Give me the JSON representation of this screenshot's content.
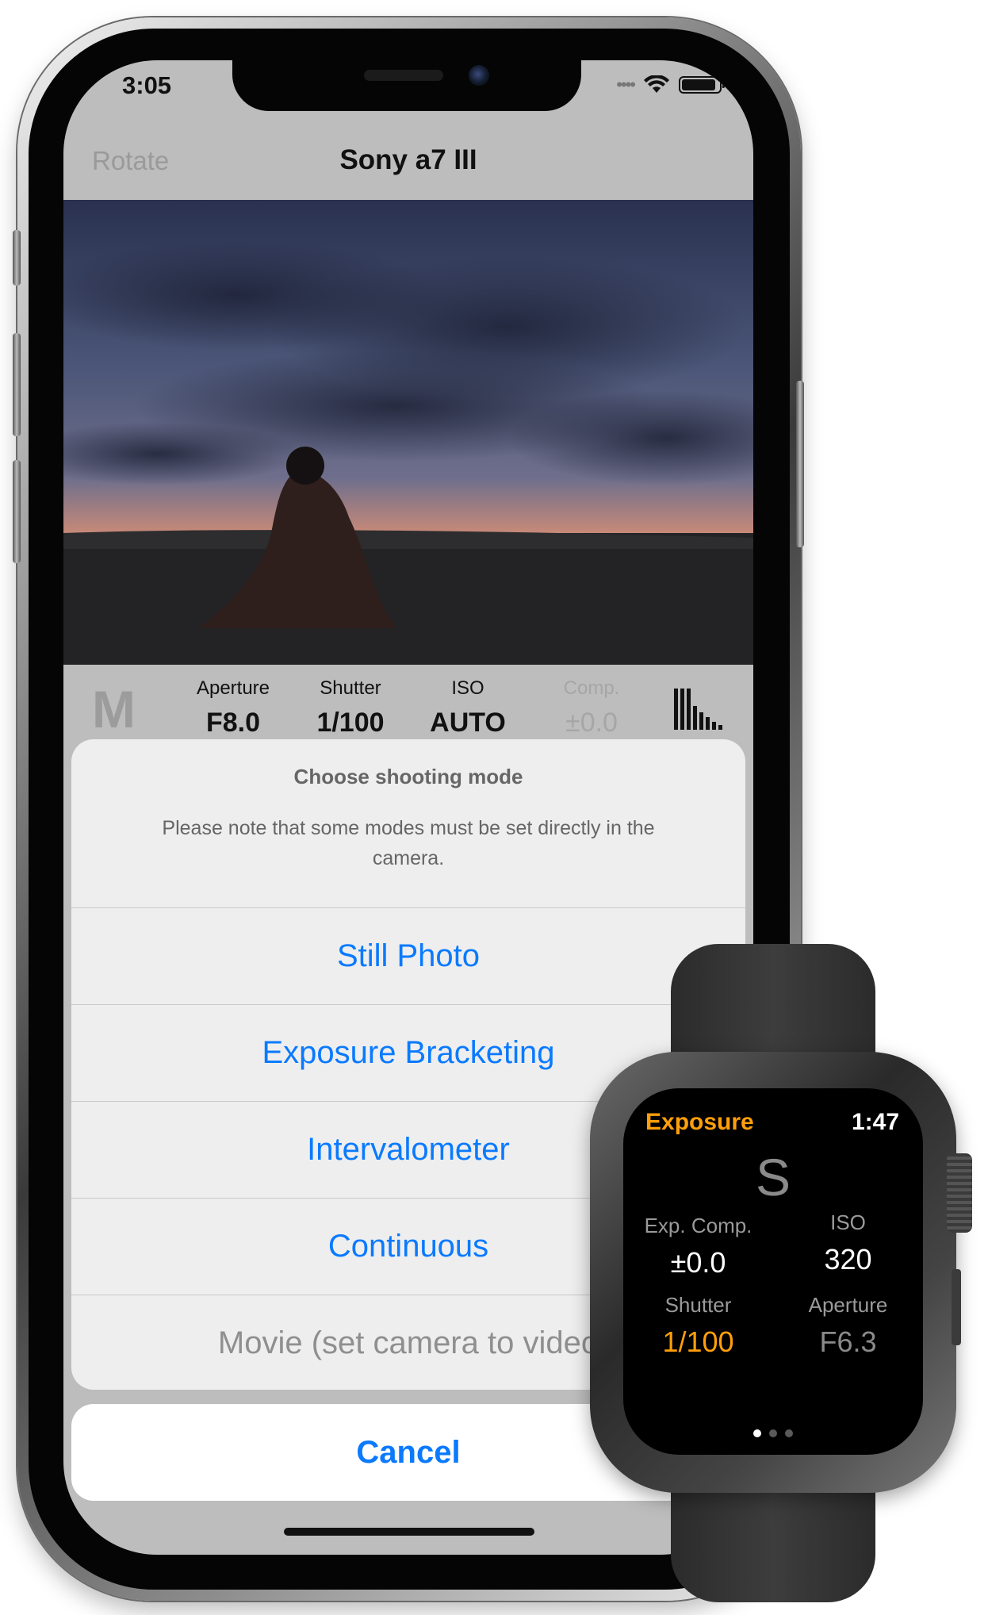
{
  "phone": {
    "status_bar": {
      "time": "3:05",
      "signal_icon": "cellular-signal-icon",
      "wifi_icon": "wifi-icon",
      "battery_icon": "battery-icon"
    },
    "nav": {
      "left_button": "Rotate",
      "title": "Sony a7 III"
    },
    "live_view": {
      "description_icon": "live-view-image"
    },
    "controls": {
      "mode": "M",
      "aperture": {
        "label": "Aperture",
        "value": "F8.0"
      },
      "shutter": {
        "label": "Shutter",
        "value": "1/100"
      },
      "iso": {
        "label": "ISO",
        "value": "AUTO"
      },
      "comp": {
        "label": "Comp.",
        "value": "±0.0"
      },
      "meter_icon": "exposure-meter-icon"
    },
    "action_sheet": {
      "title": "Choose shooting mode",
      "message": "Please note that some modes must be set directly in the camera.",
      "options": [
        {
          "label": "Still Photo",
          "enabled": true
        },
        {
          "label": "Exposure Bracketing",
          "enabled": true
        },
        {
          "label": "Intervalometer",
          "enabled": true
        },
        {
          "label": "Continuous",
          "enabled": true
        },
        {
          "label": "Movie (set camera to video",
          "enabled": false
        }
      ],
      "cancel": "Cancel"
    },
    "colors": {
      "accent": "#0a7aff",
      "screen_bg": "#bdbdbd",
      "sheet_bg": "#eeeeee"
    }
  },
  "watch": {
    "title": "Exposure",
    "time": "1:47",
    "mode": "S",
    "exp_comp": {
      "label": "Exp. Comp.",
      "value": "±0.0"
    },
    "iso": {
      "label": "ISO",
      "value": "320"
    },
    "shutter": {
      "label": "Shutter",
      "value": "1/100"
    },
    "aperture": {
      "label": "Aperture",
      "value": "F6.3"
    },
    "page_dots": 3,
    "active_page": 1,
    "colors": {
      "accent": "#ff9f0a"
    }
  }
}
